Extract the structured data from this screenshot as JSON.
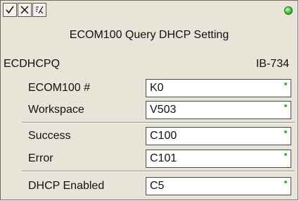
{
  "toolbar": {
    "buttons": [
      {
        "icon": "check-icon"
      },
      {
        "icon": "cancel-x-icon"
      },
      {
        "icon": "help-lookup-icon"
      }
    ],
    "status_color": "#3fd23a"
  },
  "header": {
    "title": "ECOM100 Query DHCP Setting",
    "mnemonic": "ECDHCPQ",
    "reference": "IB-734"
  },
  "fields": [
    {
      "label": "ECOM100 #",
      "value": "K0"
    },
    {
      "label": "Workspace",
      "value": "V503"
    },
    {
      "label": "Success",
      "value": "C100"
    },
    {
      "label": "Error",
      "value": "C101"
    },
    {
      "label": "DHCP Enabled",
      "value": "C5"
    }
  ]
}
